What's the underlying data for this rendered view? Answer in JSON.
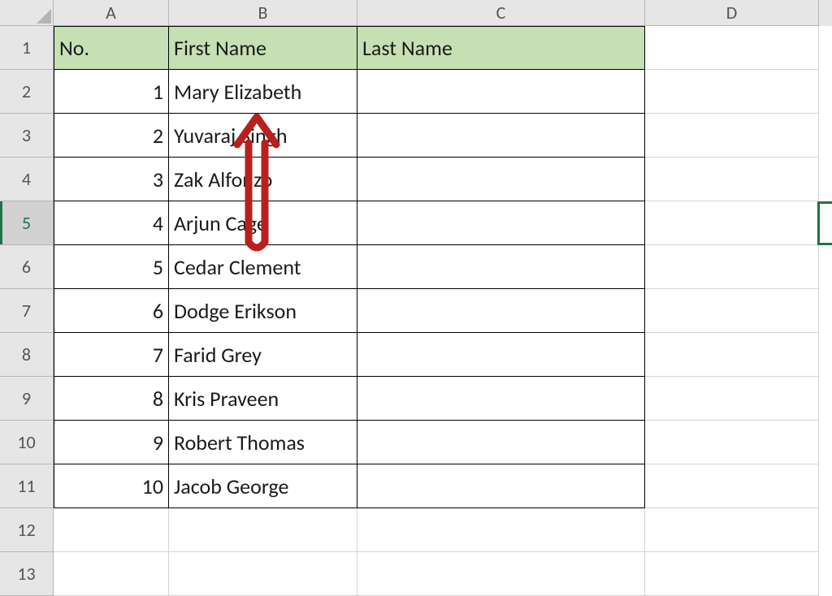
{
  "columns": [
    "A",
    "B",
    "C",
    "D"
  ],
  "row_numbers": [
    "1",
    "2",
    "3",
    "4",
    "5",
    "6",
    "7",
    "8",
    "9",
    "10",
    "11",
    "12",
    "13"
  ],
  "selected_row_header": "5",
  "table": {
    "headers": {
      "A": "No.",
      "B": "First Name",
      "C": "Last Name"
    },
    "rows": [
      {
        "no": "1",
        "first": "Mary Elizabeth",
        "last": ""
      },
      {
        "no": "2",
        "first": "Yuvaraj Singh",
        "last": ""
      },
      {
        "no": "3",
        "first": "Zak Alfonzo",
        "last": ""
      },
      {
        "no": "4",
        "first": "Arjun Cage",
        "last": ""
      },
      {
        "no": "5",
        "first": "Cedar Clement",
        "last": ""
      },
      {
        "no": "6",
        "first": "Dodge Erikson",
        "last": ""
      },
      {
        "no": "7",
        "first": "Farid Grey",
        "last": ""
      },
      {
        "no": "8",
        "first": "Kris Praveen",
        "last": ""
      },
      {
        "no": "9",
        "first": "Robert Thomas",
        "last": ""
      },
      {
        "no": "10",
        "first": "Jacob George",
        "last": ""
      }
    ]
  },
  "annotation": {
    "kind": "up-arrow",
    "color": "#b8201e"
  }
}
